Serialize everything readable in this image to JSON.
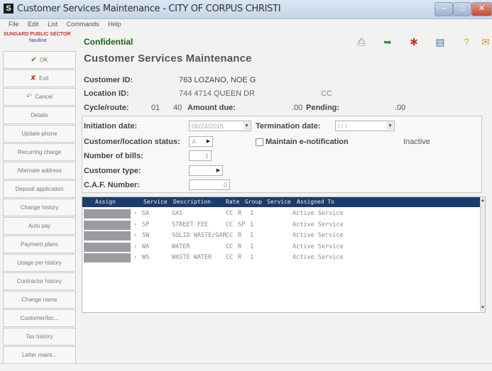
{
  "window": {
    "title": "Customer Services Maintenance - CITY OF CORPUS CHRISTI",
    "app_icon": "S",
    "buttons": {
      "minimize": "–",
      "maximize": "□",
      "close": "✕"
    }
  },
  "menu": [
    "File",
    "Edit",
    "List",
    "Commands",
    "Help"
  ],
  "logo": {
    "line1": "SUNGARD PUBLIC SECTOR",
    "line2": "Naviline"
  },
  "sidebar": {
    "items": [
      {
        "label": "OK",
        "icon": "check-icon",
        "glyph": "✔",
        "color": "#2a8a2a"
      },
      {
        "label": "Exit",
        "icon": "x-icon",
        "glyph": "✘",
        "color": "#c0392b"
      },
      {
        "label": "Cancel",
        "icon": "cancel-icon",
        "glyph": "↶",
        "color": "#999999"
      },
      {
        "label": "Details",
        "icon": "",
        "glyph": "",
        "color": ""
      },
      {
        "label": "Update phone",
        "icon": "",
        "glyph": "",
        "color": ""
      },
      {
        "label": "Recurring charge",
        "icon": "",
        "glyph": "",
        "color": ""
      },
      {
        "label": "Alternate address",
        "icon": "",
        "glyph": "",
        "color": ""
      },
      {
        "label": "Deposit application",
        "icon": "",
        "glyph": "",
        "color": ""
      },
      {
        "label": "Change history",
        "icon": "",
        "glyph": "",
        "color": ""
      },
      {
        "label": "Auto pay",
        "icon": "",
        "glyph": "",
        "color": ""
      },
      {
        "label": "Payment plans",
        "icon": "",
        "glyph": "",
        "color": ""
      },
      {
        "label": "Usage per history",
        "icon": "",
        "glyph": "",
        "color": ""
      },
      {
        "label": "Contractor history",
        "icon": "",
        "glyph": "",
        "color": ""
      },
      {
        "label": "Change name",
        "icon": "",
        "glyph": "",
        "color": ""
      },
      {
        "label": "Customer/loc...",
        "icon": "",
        "glyph": "",
        "color": ""
      },
      {
        "label": "Tax history",
        "icon": "",
        "glyph": "",
        "color": ""
      },
      {
        "label": "Letter maint...",
        "icon": "",
        "glyph": "",
        "color": ""
      }
    ]
  },
  "header": {
    "confidential": "Confidential",
    "title": "Customer Services Maintenance"
  },
  "toolbar": [
    {
      "icon": "printer-icon",
      "glyph": "⎙",
      "color": "#888888"
    },
    {
      "icon": "green-arrow-icon",
      "glyph": "➥",
      "color": "#3a8a3a"
    },
    {
      "icon": "red-tool-icon",
      "glyph": "✱",
      "color": "#c23a2a"
    },
    {
      "icon": "document-icon",
      "glyph": "▤",
      "color": "#4a6fa8"
    },
    {
      "icon": "help-icon",
      "glyph": "?",
      "color": "#d8b21a"
    },
    {
      "icon": "mail-icon",
      "glyph": "✉",
      "color": "#d89b2a"
    }
  ],
  "customer": {
    "id_label": "Customer ID:",
    "id_value": "763 LOZANO, NOE G",
    "loc_label": "Location ID:",
    "loc_value": "744 4714 QUEEN DR",
    "loc_suffix": "CC",
    "cycle_label": "Cycle/route:",
    "cycle_value": "01",
    "route_value": "40",
    "amount_label": "Amount due:",
    "amount_value": ".00",
    "pending_label": "Pending:",
    "pending_value": ".00"
  },
  "form": {
    "initiation_label": "Initiation date:",
    "initiation_value": "06/24/2015",
    "termination_label": "Termination date:",
    "termination_value": "/ / /",
    "status_label": "Customer/location status:",
    "status_value": "A",
    "notification_label": "Maintain e-notification",
    "inactive_label": "Inactive",
    "bills_label": "Number of bills:",
    "bills_value": "1",
    "type_label": "Customer type:",
    "type_value": "",
    "caf_label": "C.A.F. Number:",
    "caf_value": "0"
  },
  "grid": {
    "headers": [
      "Assign",
      "Service",
      "Description",
      "Rate",
      "Group",
      "Service",
      "Assigned To"
    ],
    "rows": [
      {
        "service": "GA",
        "description": "GAS",
        "rate": "CC",
        "group": "R",
        "num": "1",
        "assigned": "Active Service"
      },
      {
        "service": "SP",
        "description": "STREET FEE",
        "rate": "CC",
        "group": "SP",
        "num": "1",
        "assigned": "Active Service"
      },
      {
        "service": "SW",
        "description": "SOLID WASTE/GAR",
        "rate": "CC",
        "group": "R",
        "num": "1",
        "assigned": "Active Service"
      },
      {
        "service": "WA",
        "description": "WATER",
        "rate": "CC",
        "group": "R",
        "num": "1",
        "assigned": "Active Service"
      },
      {
        "service": "WS",
        "description": "WASTE WATER",
        "rate": "CC",
        "group": "R",
        "num": "1",
        "assigned": "Active Service"
      }
    ]
  }
}
